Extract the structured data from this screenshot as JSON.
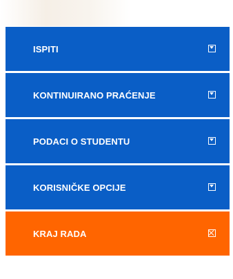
{
  "colors": {
    "nav_blue": "#0a5ec6",
    "logout_orange": "#ff6500",
    "text": "#ffffff"
  },
  "menu": {
    "items": [
      {
        "label": "ISPITI",
        "icon": "dropdown-arrow-icon",
        "color": "#0a5ec6"
      },
      {
        "label": "KONTINUIRANO PRAĆENJE",
        "icon": "dropdown-arrow-icon",
        "color": "#0a5ec6"
      },
      {
        "label": "PODACI O STUDENTU",
        "icon": "dropdown-arrow-icon",
        "color": "#0a5ec6"
      },
      {
        "label": "KORISNIČKE OPCIJE",
        "icon": "dropdown-arrow-icon",
        "color": "#0a5ec6"
      },
      {
        "label": "KRAJ RADA",
        "icon": "close-icon",
        "color": "#ff6500"
      }
    ]
  }
}
